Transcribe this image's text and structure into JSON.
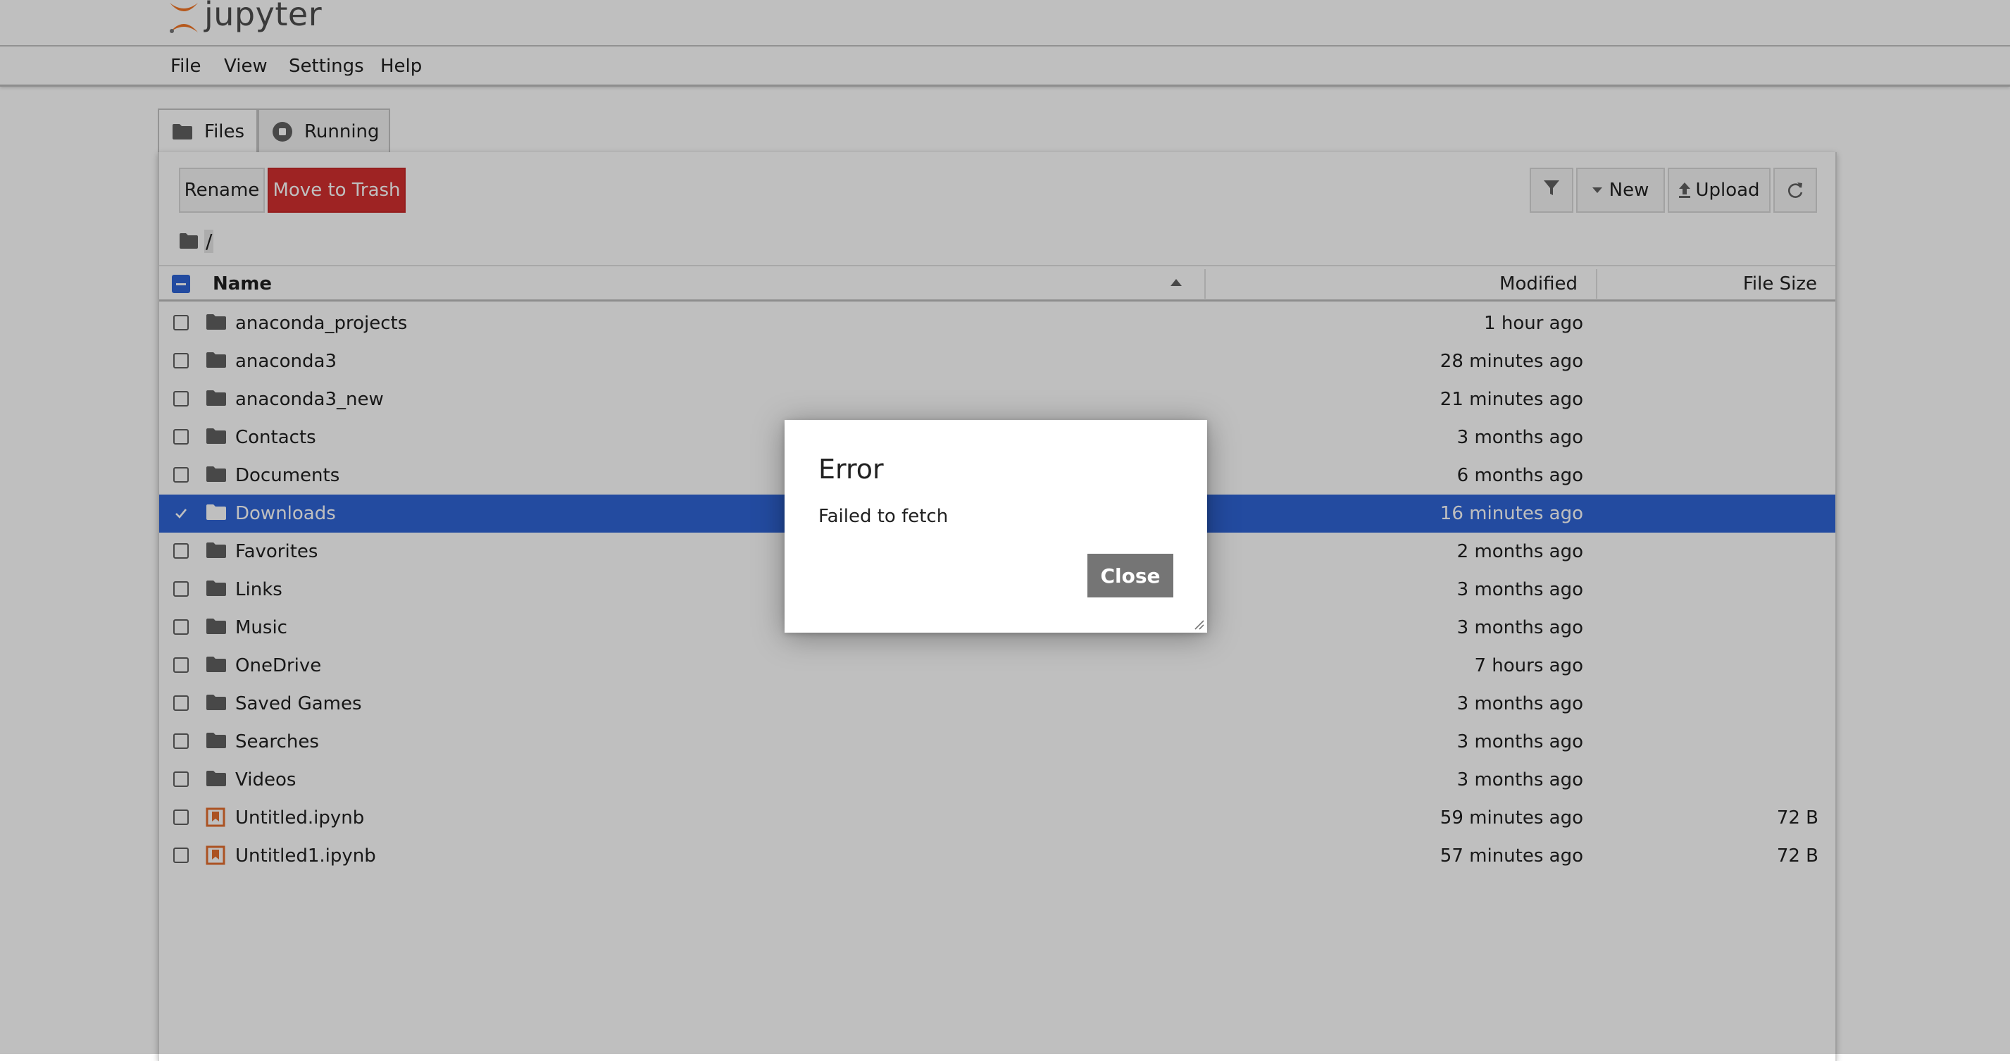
{
  "app": {
    "logo_text": "jupyter"
  },
  "menu": {
    "items": [
      "File",
      "View",
      "Settings",
      "Help"
    ]
  },
  "tabs": {
    "files_label": "Files",
    "running_label": "Running"
  },
  "toolbar": {
    "rename_label": "Rename",
    "trash_label": "Move to Trash",
    "new_label": "New",
    "upload_label": "Upload"
  },
  "breadcrumb": {
    "path": "/"
  },
  "table": {
    "headers": {
      "name": "Name",
      "modified": "Modified",
      "size": "File Size"
    },
    "rows": [
      {
        "name": "anaconda_projects",
        "modified": "1 hour ago",
        "size": "",
        "type": "folder",
        "selected": false
      },
      {
        "name": "anaconda3",
        "modified": "28 minutes ago",
        "size": "",
        "type": "folder",
        "selected": false
      },
      {
        "name": "anaconda3_new",
        "modified": "21 minutes ago",
        "size": "",
        "type": "folder",
        "selected": false
      },
      {
        "name": "Contacts",
        "modified": "3 months ago",
        "size": "",
        "type": "folder",
        "selected": false
      },
      {
        "name": "Documents",
        "modified": "6 months ago",
        "size": "",
        "type": "folder",
        "selected": false
      },
      {
        "name": "Downloads",
        "modified": "16 minutes ago",
        "size": "",
        "type": "folder",
        "selected": true
      },
      {
        "name": "Favorites",
        "modified": "2 months ago",
        "size": "",
        "type": "folder",
        "selected": false
      },
      {
        "name": "Links",
        "modified": "3 months ago",
        "size": "",
        "type": "folder",
        "selected": false
      },
      {
        "name": "Music",
        "modified": "3 months ago",
        "size": "",
        "type": "folder",
        "selected": false
      },
      {
        "name": "OneDrive",
        "modified": "7 hours ago",
        "size": "",
        "type": "folder",
        "selected": false
      },
      {
        "name": "Saved Games",
        "modified": "3 months ago",
        "size": "",
        "type": "folder",
        "selected": false
      },
      {
        "name": "Searches",
        "modified": "3 months ago",
        "size": "",
        "type": "folder",
        "selected": false
      },
      {
        "name": "Videos",
        "modified": "3 months ago",
        "size": "",
        "type": "folder",
        "selected": false
      },
      {
        "name": "Untitled.ipynb",
        "modified": "59 minutes ago",
        "size": "72 B",
        "type": "notebook",
        "selected": false
      },
      {
        "name": "Untitled1.ipynb",
        "modified": "57 minutes ago",
        "size": "72 B",
        "type": "notebook",
        "selected": false
      }
    ]
  },
  "dialog": {
    "title": "Error",
    "message": "Failed to fetch",
    "close_label": "Close"
  },
  "colors": {
    "accent": "#2f64d6",
    "danger": "#d32f2f",
    "notebook_icon": "#e46e2e",
    "logo_orange": "#f37626"
  }
}
